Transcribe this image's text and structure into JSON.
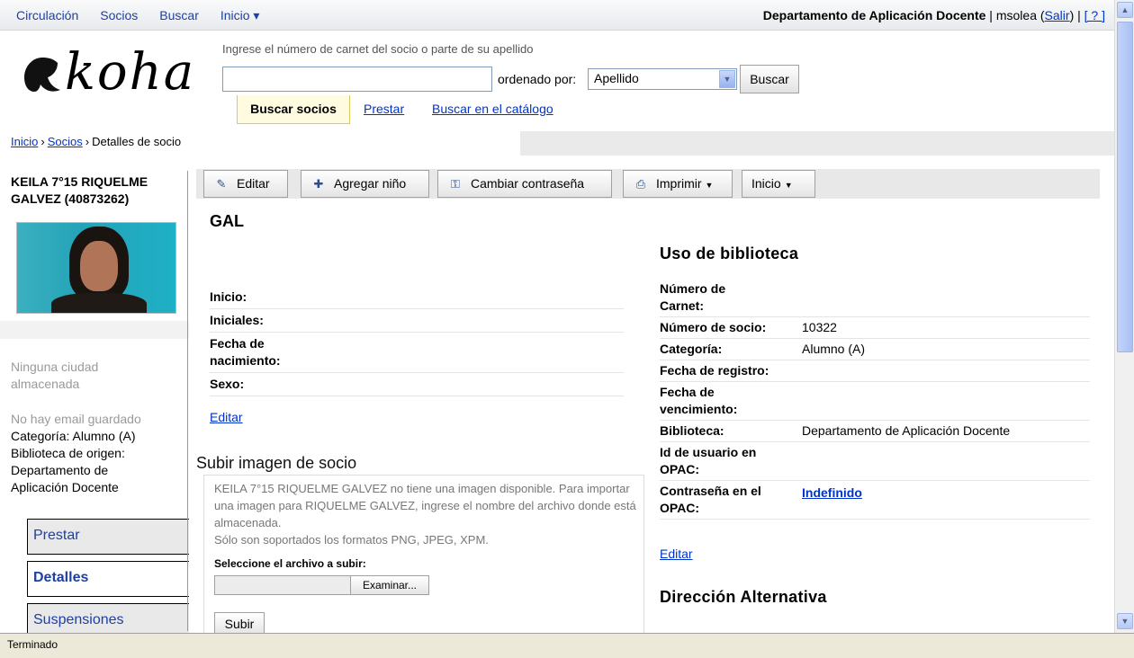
{
  "topnav": {
    "items": [
      "Circulación",
      "Socios",
      "Buscar",
      "Inicio"
    ],
    "library": "Departamento de Aplicación Docente",
    "separator": " | ",
    "user": "msolea",
    "logout": "Salir",
    "help": "[ ? ]"
  },
  "header": {
    "logo_text": "koha",
    "search_hint": "Ingrese el número de carnet del socio o parte de su apellido",
    "search_value": "",
    "order_label": "ordenado por:",
    "order_value": "Apellido",
    "search_button": "Buscar",
    "tabs": [
      "Buscar socios",
      "Prestar",
      "Buscar en el catálogo"
    ]
  },
  "breadcrumb": [
    "Inicio",
    "Socios",
    "Detalles de socio"
  ],
  "breadcrumb_sep": "›",
  "sidebar": {
    "patron_name": "KEILA 7°15 RIQUELME GALVEZ (40873262)",
    "no_city": "Ninguna ciudad almacenada",
    "no_email": "No hay email guardado",
    "category": "Categoría: Alumno (A)",
    "home_library_label": "Biblioteca de origen:",
    "home_library": "Departamento de Aplicación Docente",
    "menu": [
      "Prestar",
      "Detalles",
      "Suspensiones"
    ]
  },
  "toolbar": {
    "edit": "Editar",
    "add_child": "Agregar niño",
    "change_password": "Cambiar contraseña",
    "print": "Imprimir",
    "home": "Inicio"
  },
  "main": {
    "title": "GAL",
    "personal": [
      {
        "label": "Inicio:",
        "value": ""
      },
      {
        "label": "Iniciales:",
        "value": ""
      },
      {
        "label": "Fecha de nacimiento:",
        "value": ""
      },
      {
        "label": "Sexo:",
        "value": ""
      }
    ],
    "edit_link": "Editar",
    "upload": {
      "title": "Subir imagen de socio",
      "text": "KEILA 7°15 RIQUELME GALVEZ no tiene una imagen disponible. Para importar una imagen para RIQUELME GALVEZ, ingrese el nombre del archivo donde está almacenada.",
      "formats": "Sólo son soportados los formatos PNG, JPEG, XPM.",
      "file_label": "Seleccione el archivo a subir:",
      "browse_button": "Examinar...",
      "submit_button": "Subir"
    },
    "library_usage": {
      "title": "Uso de biblioteca",
      "rows": [
        {
          "label": "Número de Carnet:",
          "value": ""
        },
        {
          "label": "Número de socio:",
          "value": "10322"
        },
        {
          "label": "Categoría:",
          "value": "Alumno (A)"
        },
        {
          "label": "Fecha de registro:",
          "value": ""
        },
        {
          "label": "Fecha de vencimiento:",
          "value": ""
        },
        {
          "label": "Biblioteca:",
          "value": "Departamento de Aplicación Docente"
        },
        {
          "label": "Id de usuario en OPAC:",
          "value": ""
        },
        {
          "label": "Contraseña en el OPAC:",
          "value": "Indefinido"
        }
      ],
      "edit_link": "Editar"
    },
    "alt_address_title": "Dirección Alternativa"
  },
  "statusbar": {
    "text": "Terminado"
  }
}
